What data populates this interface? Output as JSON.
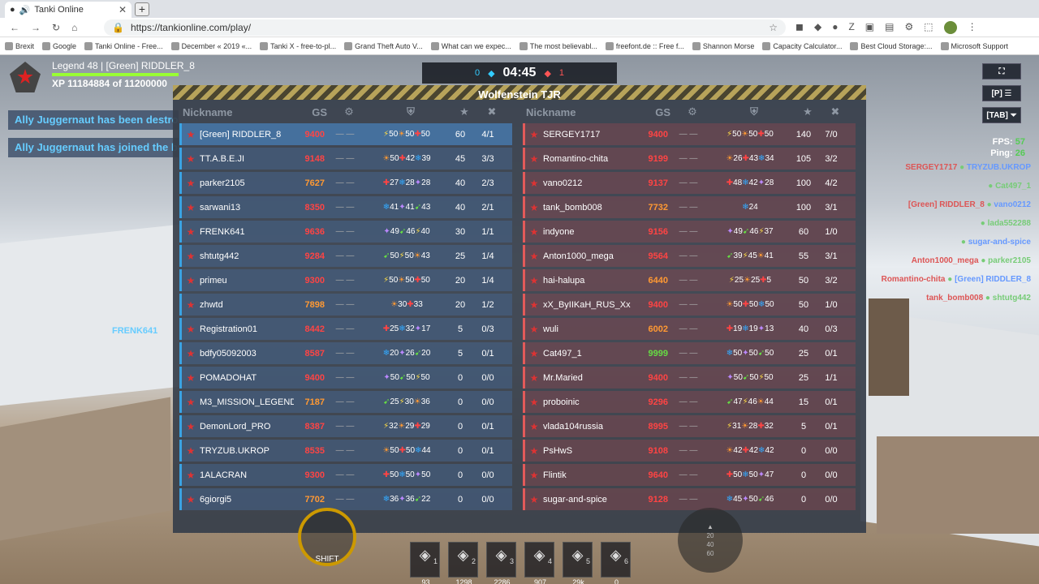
{
  "browser": {
    "tab_title": "Tanki Online",
    "url": "https://tankionline.com/play/",
    "bookmarks": [
      "Brexit",
      "Google",
      "Tanki Online - Free...",
      "December « 2019 «...",
      "Tanki X - free-to-pl...",
      "Grand Theft Auto V...",
      "What can we expec...",
      "The most believabl...",
      "freefont.de :: Free f...",
      "Shannon Morse",
      "Capacity Calculator...",
      "Best Cloud Storage:...",
      "Microsoft Support"
    ]
  },
  "hud": {
    "rank_line": "Legend 48 | [Green] RIDDLER_8",
    "xp_line": "XP 11184884 of 11200000",
    "xp_progress": 0.9986,
    "feed": [
      "Ally Juggernaut has been destroyed",
      "Ally Juggernaut has joined the battle"
    ],
    "blue_score": "0",
    "red_score": "1",
    "timer": "04:45",
    "fullscreen": "⛶",
    "pause_label": "[P] ☰",
    "tab_label": "[TAB] ⏷",
    "fps_label": "FPS:",
    "fps_value": "57",
    "ping_label": "Ping:",
    "ping_value": "26",
    "tank_name": "FRENK641",
    "shift_label": "SHIFT",
    "minimap_marks": [
      "20",
      "40",
      "60"
    ],
    "slots": [
      {
        "num": "1",
        "count": "93"
      },
      {
        "num": "2",
        "count": "1298"
      },
      {
        "num": "3",
        "count": "2286"
      },
      {
        "num": "4",
        "count": "907"
      },
      {
        "num": "5",
        "count": "29k"
      },
      {
        "num": "6",
        "count": "0"
      }
    ]
  },
  "killfeed": [
    {
      "a": "SERGEY1717",
      "b": "TRYZUB.UKROP"
    },
    {
      "a": "",
      "b": "Cat497_1"
    },
    {
      "a": "[Green] RIDDLER_8",
      "b": "vano0212"
    },
    {
      "a": "",
      "b": "lada552288"
    },
    {
      "a": "",
      "b": "sugar-and-spice"
    },
    {
      "a": "Anton1000_mega",
      "b": "parker2105"
    },
    {
      "a": "Romantino-chita",
      "b": "[Green] RIDDLER_8"
    },
    {
      "a": "tank_bomb008",
      "b": "shtutg442"
    }
  ],
  "board": {
    "map_title": "Wolfenstein TJR",
    "nickname_header": "Nickname",
    "gs_header": "GS",
    "blue": [
      {
        "nick": "[Green] RIDDLER_8",
        "gs": "9400",
        "r": [
          "50",
          "50",
          "50"
        ],
        "score": "60",
        "kd": "4/1"
      },
      {
        "nick": "TT.A.B.E.JI",
        "gs": "9148",
        "r": [
          "50",
          "42",
          "39"
        ],
        "score": "45",
        "kd": "3/3"
      },
      {
        "nick": "parker2105",
        "gs": "7627",
        "r": [
          "27",
          "28",
          "28"
        ],
        "score": "40",
        "kd": "2/3"
      },
      {
        "nick": "sarwani13",
        "gs": "8350",
        "r": [
          "41",
          "41",
          "43"
        ],
        "score": "40",
        "kd": "2/1"
      },
      {
        "nick": "FRENK641",
        "gs": "9636",
        "r": [
          "49",
          "46",
          "40"
        ],
        "score": "30",
        "kd": "1/1"
      },
      {
        "nick": "shtutg442",
        "gs": "9284",
        "r": [
          "50",
          "50",
          "43"
        ],
        "score": "25",
        "kd": "1/4"
      },
      {
        "nick": "primeu",
        "gs": "9300",
        "r": [
          "50",
          "50",
          "50"
        ],
        "score": "20",
        "kd": "1/4"
      },
      {
        "nick": "zhwtd",
        "gs": "7898",
        "r": [
          "30",
          "33",
          ""
        ],
        "score": "20",
        "kd": "1/2"
      },
      {
        "nick": "Registration01",
        "gs": "8442",
        "r": [
          "25",
          "32",
          "17"
        ],
        "score": "5",
        "kd": "0/3"
      },
      {
        "nick": "bdfy05092003",
        "gs": "8587",
        "r": [
          "20",
          "26",
          "20"
        ],
        "score": "5",
        "kd": "0/1"
      },
      {
        "nick": "POMADOHAT",
        "gs": "9400",
        "r": [
          "50",
          "50",
          "50"
        ],
        "score": "0",
        "kd": "0/0"
      },
      {
        "nick": "M3_MISSION_LEGEND",
        "gs": "7187",
        "r": [
          "25",
          "30",
          "36"
        ],
        "score": "0",
        "kd": "0/0"
      },
      {
        "nick": "DemonLord_PRO",
        "gs": "8387",
        "r": [
          "32",
          "29",
          "29"
        ],
        "score": "0",
        "kd": "0/1"
      },
      {
        "nick": "TRYZUB.UKROP",
        "gs": "8535",
        "r": [
          "50",
          "50",
          "44"
        ],
        "score": "0",
        "kd": "0/1"
      },
      {
        "nick": "1ALACRAN",
        "gs": "9300",
        "r": [
          "50",
          "50",
          "50"
        ],
        "score": "0",
        "kd": "0/0"
      },
      {
        "nick": "6giorgi5",
        "gs": "7702",
        "r": [
          "36",
          "36",
          "22"
        ],
        "score": "0",
        "kd": "0/0"
      }
    ],
    "red": [
      {
        "nick": "SERGEY1717",
        "gs": "9400",
        "r": [
          "50",
          "50",
          "50"
        ],
        "score": "140",
        "kd": "7/0"
      },
      {
        "nick": "Romantino-chita",
        "gs": "9199",
        "r": [
          "26",
          "43",
          "34"
        ],
        "score": "105",
        "kd": "3/2"
      },
      {
        "nick": "vano0212",
        "gs": "9137",
        "r": [
          "48",
          "42",
          "28"
        ],
        "score": "100",
        "kd": "4/2"
      },
      {
        "nick": "tank_bomb008",
        "gs": "7732",
        "r": [
          "24",
          "",
          ""
        ],
        "score": "100",
        "kd": "3/1"
      },
      {
        "nick": "indyone",
        "gs": "9156",
        "r": [
          "49",
          "46",
          "37"
        ],
        "score": "60",
        "kd": "1/0"
      },
      {
        "nick": "Anton1000_mega",
        "gs": "9564",
        "r": [
          "39",
          "45",
          "41"
        ],
        "score": "55",
        "kd": "3/1"
      },
      {
        "nick": "hai-halupa",
        "gs": "6440",
        "r": [
          "25",
          "25",
          "5"
        ],
        "score": "50",
        "kd": "3/2"
      },
      {
        "nick": "xX_ByIIKaH_RUS_Xx",
        "gs": "9400",
        "r": [
          "50",
          "50",
          "50"
        ],
        "score": "50",
        "kd": "1/0"
      },
      {
        "nick": "wuli",
        "gs": "6002",
        "r": [
          "19",
          "19",
          "13"
        ],
        "score": "40",
        "kd": "0/3"
      },
      {
        "nick": "Cat497_1",
        "gs": "9999",
        "r": [
          "50",
          "50",
          "50"
        ],
        "score": "25",
        "kd": "0/1"
      },
      {
        "nick": "Mr.Maried",
        "gs": "9400",
        "r": [
          "50",
          "50",
          "50"
        ],
        "score": "25",
        "kd": "1/1"
      },
      {
        "nick": "proboinic",
        "gs": "9296",
        "r": [
          "47",
          "46",
          "44"
        ],
        "score": "15",
        "kd": "0/1"
      },
      {
        "nick": "vlada104russia",
        "gs": "8995",
        "r": [
          "31",
          "28",
          "32"
        ],
        "score": "5",
        "kd": "0/1"
      },
      {
        "nick": "PsHwS",
        "gs": "9108",
        "r": [
          "42",
          "42",
          "42"
        ],
        "score": "0",
        "kd": "0/0"
      },
      {
        "nick": "Flintik",
        "gs": "9640",
        "r": [
          "50",
          "50",
          "47"
        ],
        "score": "0",
        "kd": "0/0"
      },
      {
        "nick": "sugar-and-spice",
        "gs": "9128",
        "r": [
          "45",
          "50",
          "46"
        ],
        "score": "0",
        "kd": "0/0"
      }
    ]
  }
}
